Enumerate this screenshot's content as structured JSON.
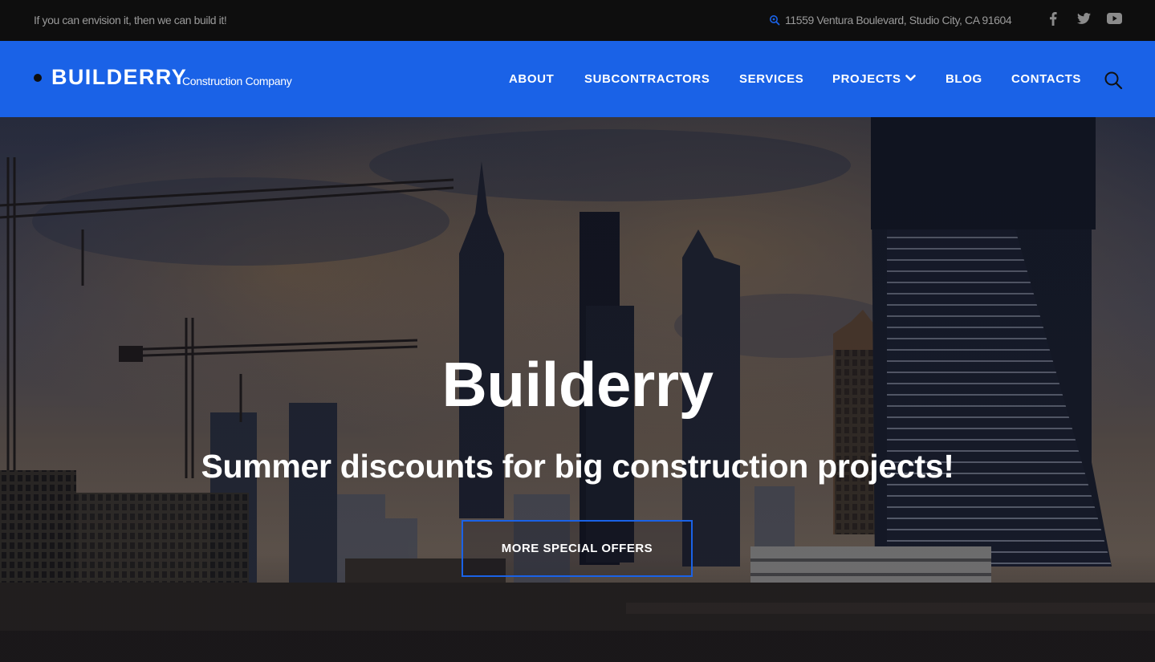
{
  "topbar": {
    "tagline": "If you can envision it, then we can build it!",
    "address": "11559 Ventura Boulevard, Studio City, CA 91604",
    "address_icon": "map-pin-icon",
    "social": [
      "facebook-icon",
      "twitter-icon",
      "youtube-icon"
    ]
  },
  "brand": {
    "name": "BUILDERRY",
    "subtitle": "Construction Company",
    "accent_color": "#1a62e7"
  },
  "nav": {
    "items": [
      {
        "label": "ABOUT"
      },
      {
        "label": "SUBCONTRACTORS"
      },
      {
        "label": "SERVICES"
      },
      {
        "label": "PROJECTS",
        "has_dropdown": true
      },
      {
        "label": "BLOG"
      },
      {
        "label": "CONTACTS"
      }
    ],
    "search_icon": "search-icon"
  },
  "hero": {
    "title": "Builderry",
    "subtitle": "Summer discounts for big construction projects!",
    "cta_label": "MORE SPECIAL OFFERS"
  }
}
